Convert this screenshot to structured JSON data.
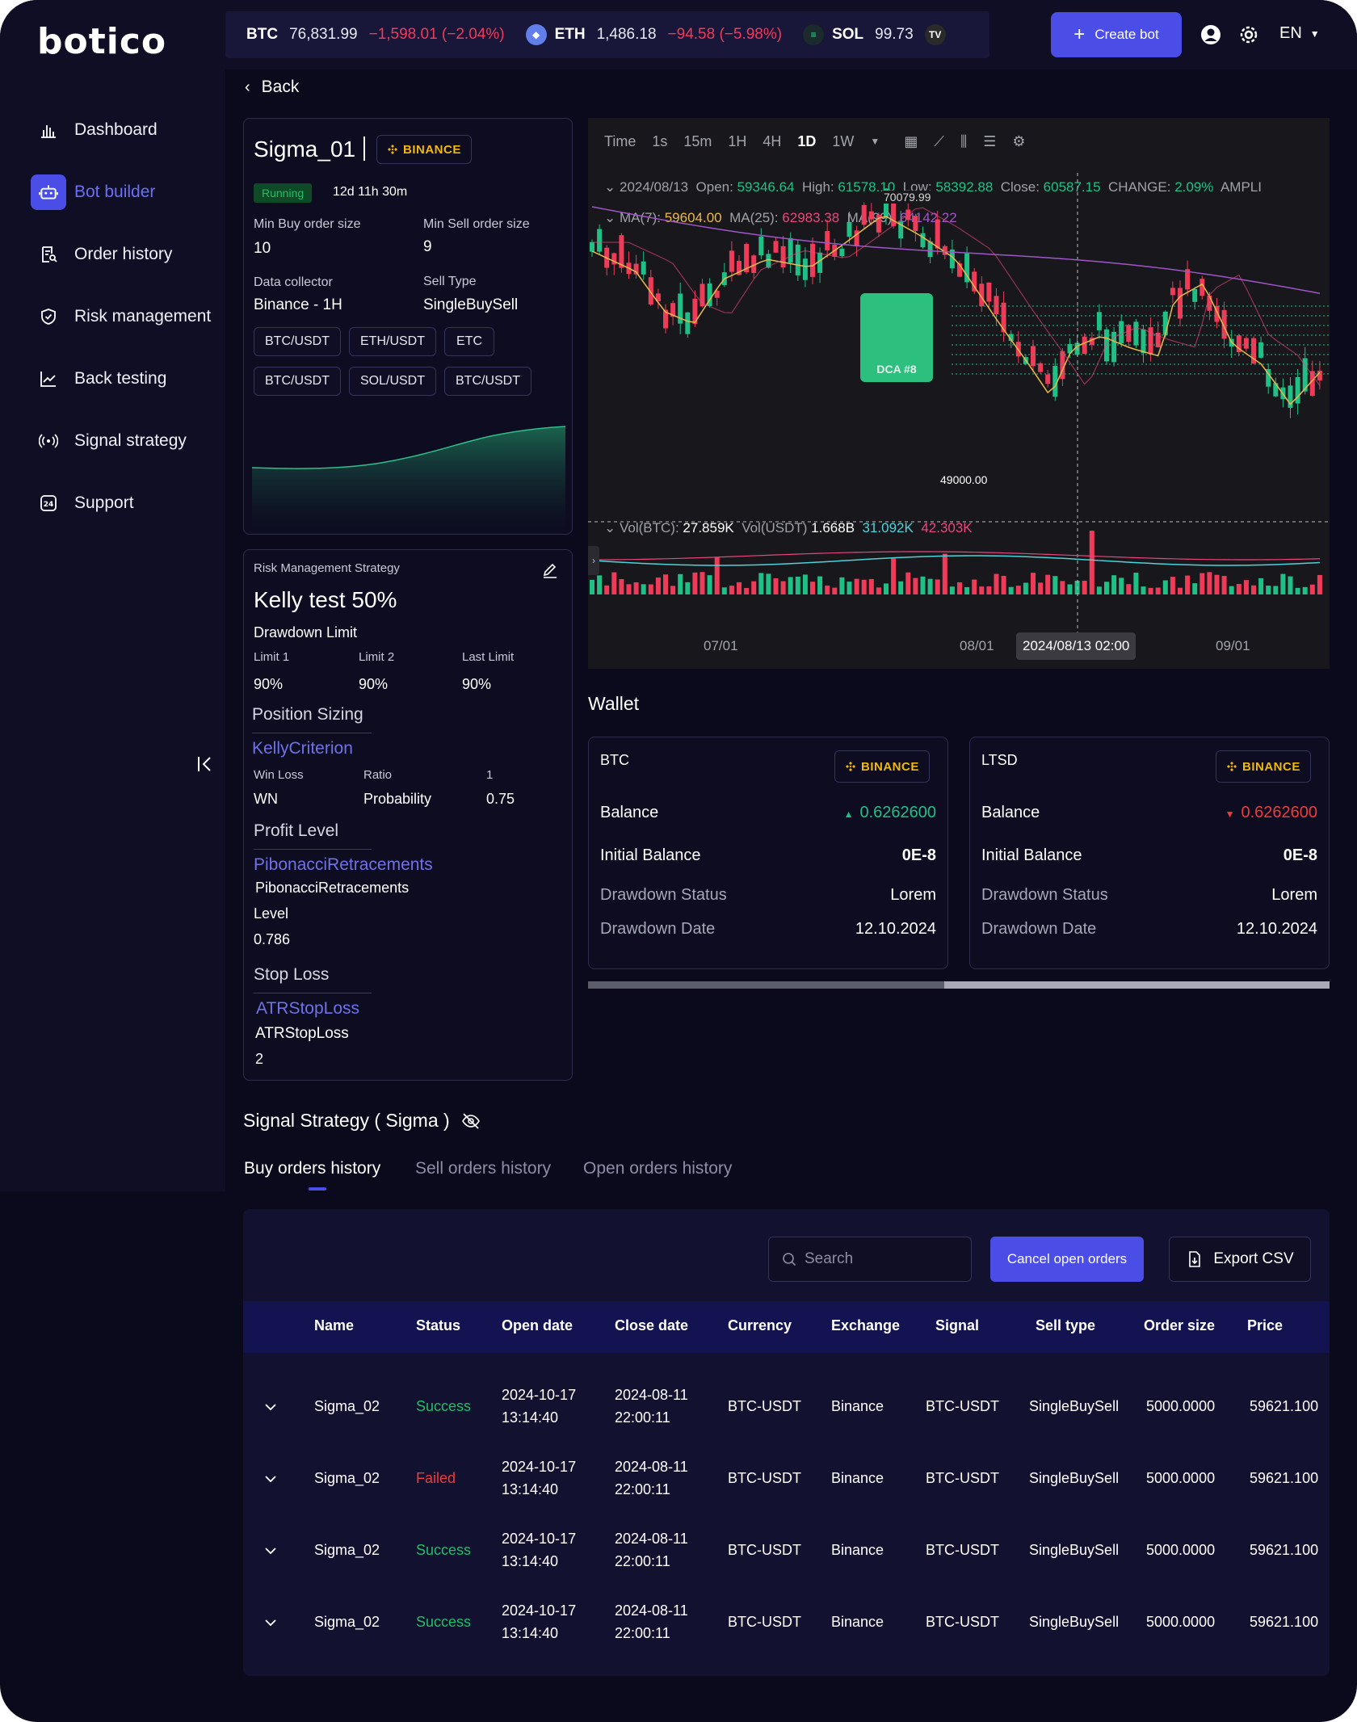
{
  "app": {
    "logo": "botico"
  },
  "ticker": [
    {
      "sym": "BTC",
      "price": "76,831.99",
      "change": "−1,598.01 (−2.04%)",
      "coin_color": "#f7931a"
    },
    {
      "sym": "ETH",
      "price": "1,486.18",
      "change": "−94.58 (−5.98%)",
      "coin_color": "#627eea"
    },
    {
      "sym": "SOL",
      "price": "99.73",
      "change": "",
      "coin_color": "#14f195"
    }
  ],
  "header": {
    "create_bot": "Create bot",
    "lang": "EN"
  },
  "sidebar": {
    "items": [
      {
        "label": "Dashboard",
        "icon": "chart-bar-icon"
      },
      {
        "label": "Bot builder",
        "icon": "robot-icon"
      },
      {
        "label": "Order history",
        "icon": "receipt-search-icon"
      },
      {
        "label": "Risk management",
        "icon": "shield-check-icon"
      },
      {
        "label": "Back testing",
        "icon": "trend-up-icon"
      },
      {
        "label": "Signal  strategy",
        "icon": "broadcast-icon"
      },
      {
        "label": "Support",
        "icon": "support-24-icon"
      }
    ]
  },
  "back": "Back",
  "bot": {
    "name": "Sigma_01",
    "exchange_badge": "BINANCE",
    "status": "Running",
    "uptime": "12d 11h 30m",
    "min_buy_label": "Min Buy order size",
    "min_buy_value": "10",
    "min_sell_label": "Min Sell order size",
    "min_sell_value": "9",
    "collector_label": "Data collector",
    "collector_value": "Binance - 1H",
    "sell_type_label": "Sell Type",
    "sell_type_value": "SingleBuySell",
    "pairs": [
      "BTC/USDT",
      "ETH/USDT",
      "ETC",
      "BTC/USDT",
      "SOL/USDT",
      "BTC/USDT"
    ]
  },
  "risk": {
    "header": "Risk Management Strategy",
    "name": "Kelly test 50%",
    "drawdown_title": "Drawdown Limit",
    "limits": [
      {
        "label": "Limit 1",
        "value": "90%"
      },
      {
        "label": "Limit 2",
        "value": "90%"
      },
      {
        "label": "Last Limit",
        "value": "90%"
      }
    ],
    "position_title": "Position Sizing",
    "position_link": "KellyCriterion",
    "ps_labels": [
      "Win Loss",
      "Ratio",
      "1"
    ],
    "ps_values": [
      "WN",
      "Probability",
      "0.75"
    ],
    "profit_title": "Profit Level",
    "profit_link": "PibonacciRetracements",
    "profit_name": "PibonacciRetracements",
    "profit_level_label": "Level",
    "profit_level_value": "0.786",
    "stop_title": "Stop Loss",
    "stop_link": "ATRStopLoss",
    "stop_name": "ATRStopLoss",
    "stop_value": "2"
  },
  "chart": {
    "toolbar": [
      "Time",
      "1s",
      "15m",
      "1H",
      "4H",
      "1D",
      "1W"
    ],
    "selected": "1D",
    "ohlc": {
      "date": "2024/08/13",
      "open_l": "Open:",
      "open": "59346.64",
      "high_l": "High:",
      "high": "61578.10",
      "low_l": "Low:",
      "low": "58392.88",
      "close_l": "Close:",
      "close": "60587.15",
      "change_l": "CHANGE:",
      "change": "2.09%",
      "ampl": "AMPLI"
    },
    "ma": {
      "ma7_l": "MA(7):",
      "ma7": "59604.00",
      "ma25_l": "MA(25):",
      "ma25": "62983.38",
      "ma99_l": "MA(99):",
      "ma99": "64142.22"
    },
    "high_marker": "70079.99",
    "low_marker": "49000.00",
    "dca_label": "DCA #8",
    "vol": {
      "btc_l": "Vol(BTC):",
      "btc": "27.859K",
      "usdt_l": "Vol(USDT)",
      "usdt": "1.668B",
      "v1": "31.092K",
      "v2": "42.303K"
    },
    "x_labels": [
      "07/01",
      "08/01",
      "2024/08/13 02:00",
      "09/01"
    ]
  },
  "wallet": {
    "title": "Wallet",
    "cards": [
      {
        "asset": "BTC",
        "badge": "BINANCE",
        "balance_l": "Balance",
        "balance": "0.6262600",
        "dir": "up",
        "init_l": "Initial Balance",
        "init": "0E-8",
        "dd_status_l": "Drawdown Status",
        "dd_status": "Lorem",
        "dd_date_l": "Drawdown Date",
        "dd_date": "12.10.2024"
      },
      {
        "asset": "LTSD",
        "badge": "BINANCE",
        "balance_l": "Balance",
        "balance": "0.6262600",
        "dir": "down",
        "init_l": "Initial Balance",
        "init": "0E-8",
        "dd_status_l": "Drawdown Status",
        "dd_status": "Lorem",
        "dd_date_l": "Drawdown Date",
        "dd_date": "12.10.2024"
      }
    ]
  },
  "signal": {
    "title": "Signal Strategy ( Sigma )",
    "tabs": [
      "Buy orders history",
      "Sell orders history",
      "Open orders history"
    ],
    "search_placeholder": "Search",
    "cancel": "Cancel open orders",
    "export": "Export CSV",
    "columns": [
      "Name",
      "Status",
      "Open date",
      "Close date",
      "Currency",
      "Exchange",
      "Signal",
      "Sell type",
      "Order size",
      "Price"
    ],
    "rows": [
      {
        "name": "Sigma_02",
        "status": "Success",
        "open_d": "2024-10-17",
        "open_t": "13:14:40",
        "close_d": "2024-08-11",
        "close_t": "22:00:11",
        "currency": "BTC-USDT",
        "exchange": "Binance",
        "signal": "BTC-USDT",
        "sell_type": "SingleBuySell",
        "size": "5000.0000",
        "price": "59621.100"
      },
      {
        "name": "Sigma_02",
        "status": "Failed",
        "open_d": "2024-10-17",
        "open_t": "13:14:40",
        "close_d": "2024-08-11",
        "close_t": "22:00:11",
        "currency": "BTC-USDT",
        "exchange": "Binance",
        "signal": "BTC-USDT",
        "sell_type": "SingleBuySell",
        "size": "5000.0000",
        "price": "59621.100"
      },
      {
        "name": "Sigma_02",
        "status": "Success",
        "open_d": "2024-10-17",
        "open_t": "13:14:40",
        "close_d": "2024-08-11",
        "close_t": "22:00:11",
        "currency": "BTC-USDT",
        "exchange": "Binance",
        "signal": "BTC-USDT",
        "sell_type": "SingleBuySell",
        "size": "5000.0000",
        "price": "59621.100"
      },
      {
        "name": "Sigma_02",
        "status": "Success",
        "open_d": "2024-10-17",
        "open_t": "13:14:40",
        "close_d": "2024-08-11",
        "close_t": "22:00:11",
        "currency": "BTC-USDT",
        "exchange": "Binance",
        "signal": "BTC-USDT",
        "sell_type": "SingleBuySell",
        "size": "5000.0000",
        "price": "59621.100"
      }
    ]
  },
  "colors": {
    "accent": "#4a4ee6",
    "success": "#1fbf66",
    "failed": "#ef3b3b",
    "up": "#1fbf86",
    "down": "#ef3b58"
  }
}
